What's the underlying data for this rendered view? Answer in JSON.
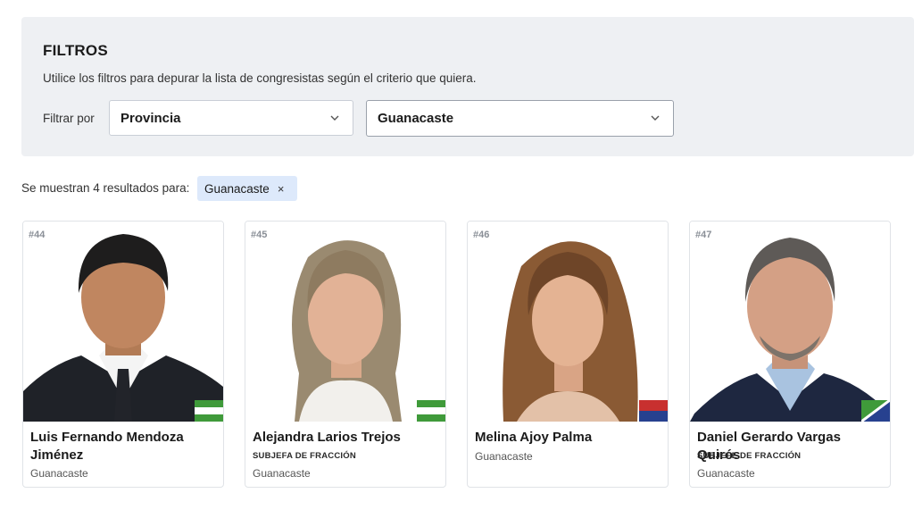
{
  "filters": {
    "title": "FILTROS",
    "description": "Utilice los filtros para depurar la lista de congresistas según el criterio que quiera.",
    "filter_label": "Filtrar por",
    "select_type": {
      "value": "Provincia"
    },
    "select_value": {
      "value": "Guanacaste"
    }
  },
  "results": {
    "text": "Se muestran 4 resultados para:",
    "chip_label": "Guanacaste",
    "chip_close": "×"
  },
  "cards": [
    {
      "number": "#44",
      "name": "Luis Fernando Mendoza Jiménez",
      "role": "",
      "province": "Guanacaste",
      "flag": "green-white"
    },
    {
      "number": "#45",
      "name": "Alejandra Larios Trejos",
      "role": "SUBJEFA DE FRACCIÓN",
      "province": "Guanacaste",
      "flag": "green-white"
    },
    {
      "number": "#46",
      "name": "Melina Ajoy Palma",
      "role": "",
      "province": "Guanacaste",
      "flag": "red-blue"
    },
    {
      "number": "#47",
      "name": "Daniel Gerardo Vargas Quirós",
      "role": "SUBJEFE DE FRACCIÓN",
      "province": "Guanacaste",
      "flag": "green-blue"
    }
  ],
  "colors": {
    "panel_bg": "#eef0f3",
    "chip_bg": "#dde9fb",
    "green": "#3f9a3a",
    "red": "#c8302f",
    "blue": "#27418f"
  }
}
